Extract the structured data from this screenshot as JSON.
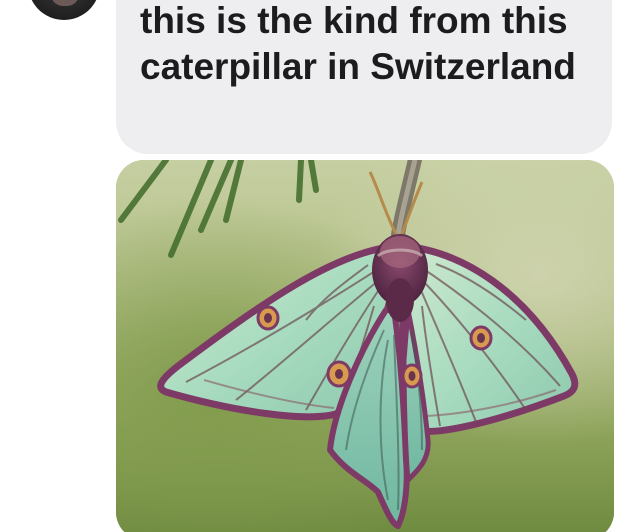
{
  "conversation": {
    "sender_avatar": "avatar-photo",
    "message": {
      "text": "this is the kind from this caterpillar in Switzerland",
      "bubble_color": "#eeeef0",
      "text_color": "#1c1c1e"
    },
    "attachment": {
      "type": "photo",
      "subject": "luna-moth-photo"
    }
  }
}
